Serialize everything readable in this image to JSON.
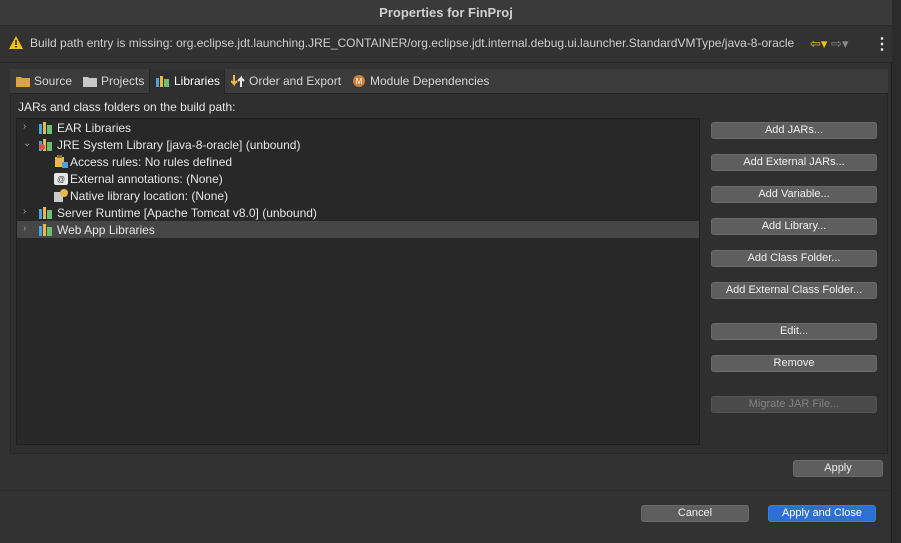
{
  "window": {
    "title": "Properties for FinProj"
  },
  "message": {
    "icon": "warning-icon",
    "text": "Build path entry is missing: org.eclipse.jdt.launching.JRE_CONTAINER/org.eclipse.jdt.internal.debug.ui.launcher.StandardVMType/java-8-oracle",
    "back": "⇦▾",
    "forward": "⇨▾",
    "menu": "⋮"
  },
  "tabs": [
    {
      "label": "Source",
      "icon": "source-folder-icon"
    },
    {
      "label": "Projects",
      "icon": "projects-folder-icon"
    },
    {
      "label": "Libraries",
      "icon": "libraries-icon",
      "active": true
    },
    {
      "label": "Order and Export",
      "icon": "order-export-icon"
    },
    {
      "label": "Module Dependencies",
      "icon": "module-icon"
    }
  ],
  "heading": "JARs and class folders on the build path:",
  "tree": [
    {
      "label": "EAR Libraries",
      "chevron": "›",
      "icon": "library-icon"
    },
    {
      "label": "JRE System Library [java-8-oracle] (unbound)",
      "chevron": "⌄",
      "icon": "jre-library-error-icon"
    },
    {
      "label": "Access rules: No rules defined",
      "chevron": "",
      "icon": "access-rules-icon"
    },
    {
      "label": "External annotations: (None)",
      "chevron": "",
      "icon": "annotations-icon"
    },
    {
      "label": "Native library location: (None)",
      "chevron": "",
      "icon": "native-library-icon"
    },
    {
      "label": "Server Runtime [Apache Tomcat v8.0] (unbound)",
      "chevron": "›",
      "icon": "library-icon"
    },
    {
      "label": "Web App Libraries",
      "chevron": "›",
      "icon": "library-icon",
      "selected": true
    }
  ],
  "buttons": {
    "add_jars": "Add JARs...",
    "add_external_jars": "Add External JARs...",
    "add_variable": "Add Variable...",
    "add_library": "Add Library...",
    "add_class_folder": "Add Class Folder...",
    "add_external_class_folder": "Add External Class Folder...",
    "edit": "Edit...",
    "remove": "Remove",
    "migrate_jar": "Migrate JAR File...",
    "apply": "Apply",
    "cancel": "Cancel",
    "apply_close": "Apply and Close"
  },
  "colors": {
    "accent": "#2e6fd3",
    "warning": "#f1c40f",
    "background": "#323232"
  }
}
